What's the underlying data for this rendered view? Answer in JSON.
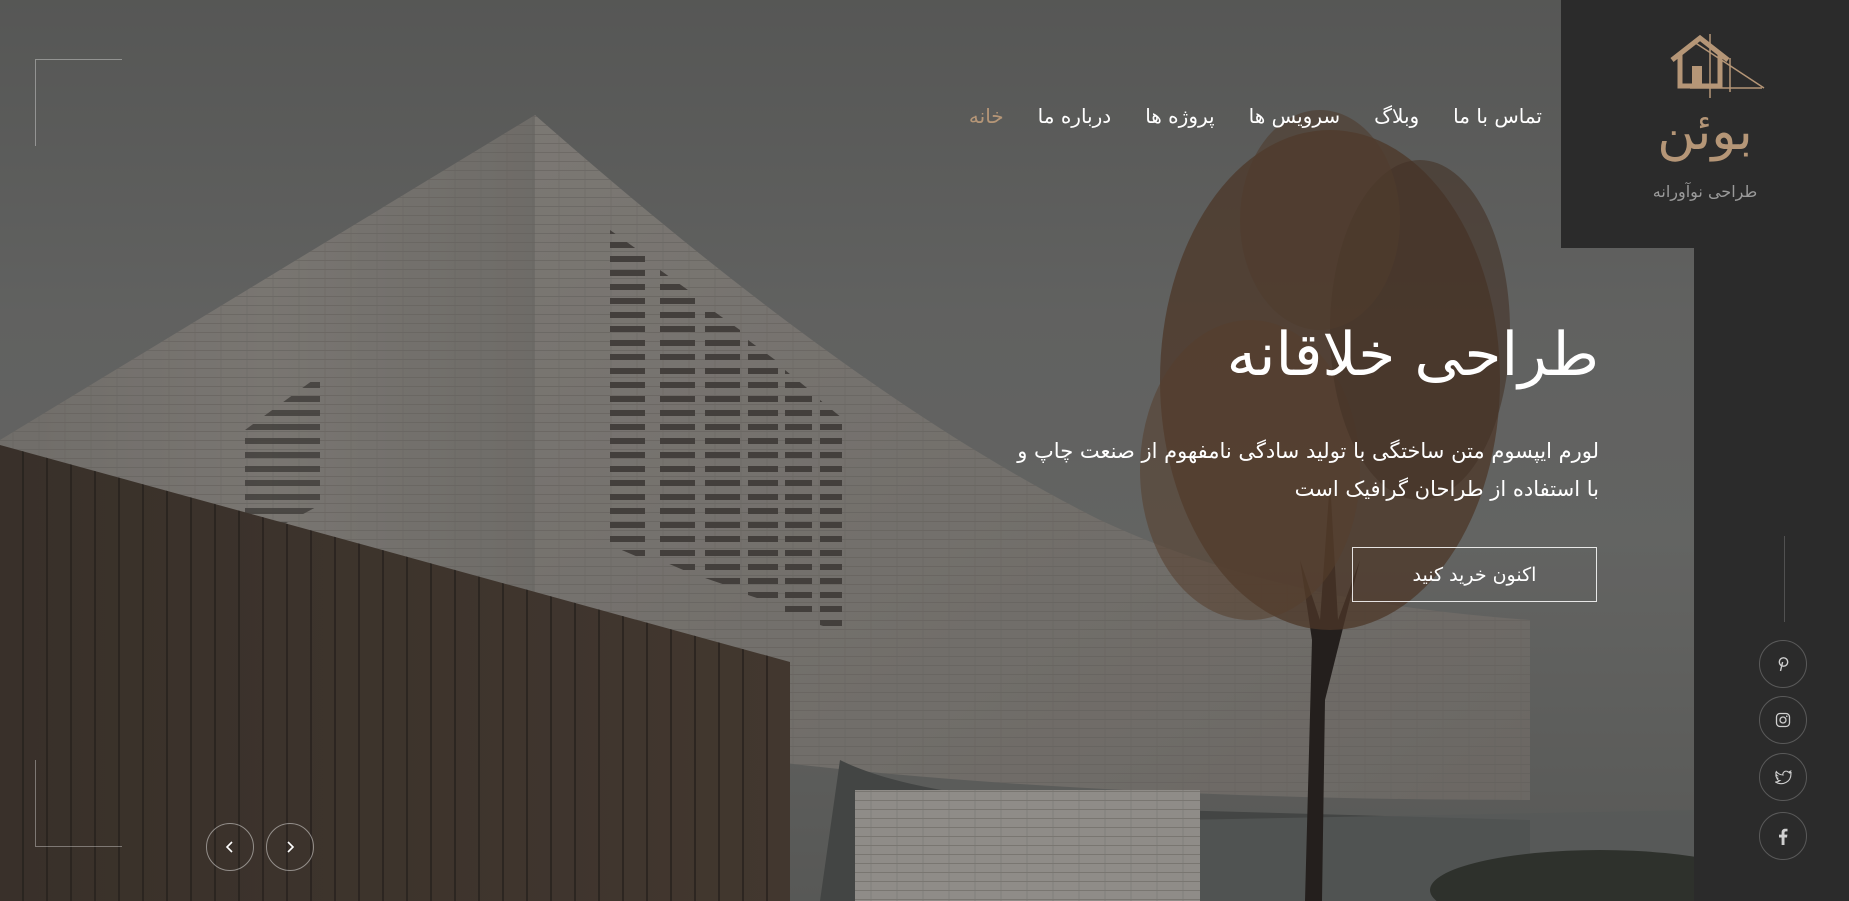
{
  "brand": {
    "name": "بوئن",
    "tagline": "طراحی نوآورانه",
    "accent_color": "#b59677",
    "logo_icon": "house-logo-icon"
  },
  "nav": {
    "items": [
      {
        "label": "خانه",
        "active": true
      },
      {
        "label": "درباره ما",
        "active": false
      },
      {
        "label": "پروژه ها",
        "active": false
      },
      {
        "label": "سرویس ها",
        "active": false
      },
      {
        "label": "وبلاگ",
        "active": false
      },
      {
        "label": "تماس با ما",
        "active": false
      }
    ]
  },
  "hero": {
    "title": "طراحی خلاقانه",
    "description": "لورم ایپسوم متن ساختگی با تولید سادگی نامفهوم از صنعت چاپ و با استفاده از طراحان گرافیک است",
    "cta_label": "اکنون خرید کنید"
  },
  "slider": {
    "prev_icon": "chevron-left-icon",
    "next_icon": "chevron-right-icon"
  },
  "social": [
    {
      "name": "pinterest-icon"
    },
    {
      "name": "instagram-icon"
    },
    {
      "name": "twitter-icon"
    },
    {
      "name": "facebook-icon"
    }
  ],
  "colors": {
    "sidebar_bg": "#2b2b2b",
    "text": "#ffffff"
  }
}
